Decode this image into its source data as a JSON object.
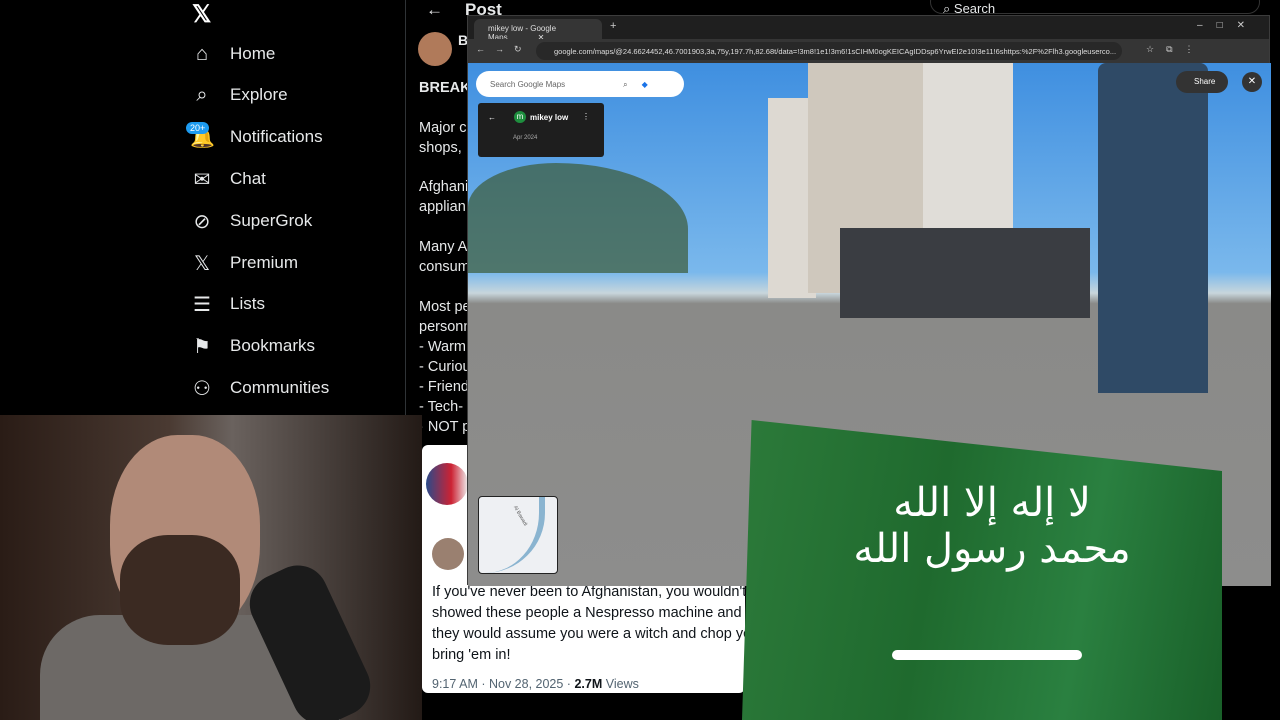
{
  "sidebar": {
    "logo": "𝕏",
    "items": [
      {
        "label": "Home",
        "icon": "⌂"
      },
      {
        "label": "Explore",
        "icon": "⌕"
      },
      {
        "label": "Notifications",
        "icon": "🔔"
      },
      {
        "label": "Chat",
        "icon": "✉"
      },
      {
        "label": "SuperGrok",
        "icon": "⊘"
      },
      {
        "label": "Premium",
        "icon": "𝕏"
      },
      {
        "label": "Lists",
        "icon": "☰"
      },
      {
        "label": "Bookmarks",
        "icon": "⚑"
      },
      {
        "label": "Communities",
        "icon": "⚇"
      }
    ],
    "notifications_badge": "20+"
  },
  "post": {
    "back_icon": "←",
    "title": "Post",
    "author_initial": "B",
    "lines": [
      "BREAK",
      "Major c",
      "shops, ",
      "Afghani",
      "applian",
      "Many A",
      "consum",
      "Most pe",
      "personn",
      "- Warm",
      "- Curiou",
      "- Friend",
      "- Tech-",
      "· NOT p"
    ]
  },
  "search": {
    "placeholder": "Search"
  },
  "quoted": {
    "text": "If you've never been to Afghanistan, you wouldn't\nshowed these people a Nespresso machine and g\nthey would assume you were a witch and chop yo\nbring 'em in!",
    "time": "9:17 AM · Nov 28, 2025 · ",
    "views_count": "2.7M",
    "views_label": "Views"
  },
  "browser": {
    "tab_title": "mikey low - Google Maps",
    "url": "google.com/maps/@24.6624452,46.7001903,3a,75y,197.7h,82.68t/data=!3m8!1e1!3m6!1sCIHM0ogKEICAgIDDsp6YrwEI2e10!3e11!6shttps:%2F%2Flh3.googleuserco...",
    "maps": {
      "search_placeholder": "Search Google Maps",
      "contributor": "mikey low",
      "contributor_initial": "m",
      "date": "Apr 2024",
      "share": "Share",
      "minimap_street": "Al Bawadi"
    }
  },
  "flag": {
    "text": "لا إله إلا الله محمد رسول الله"
  }
}
